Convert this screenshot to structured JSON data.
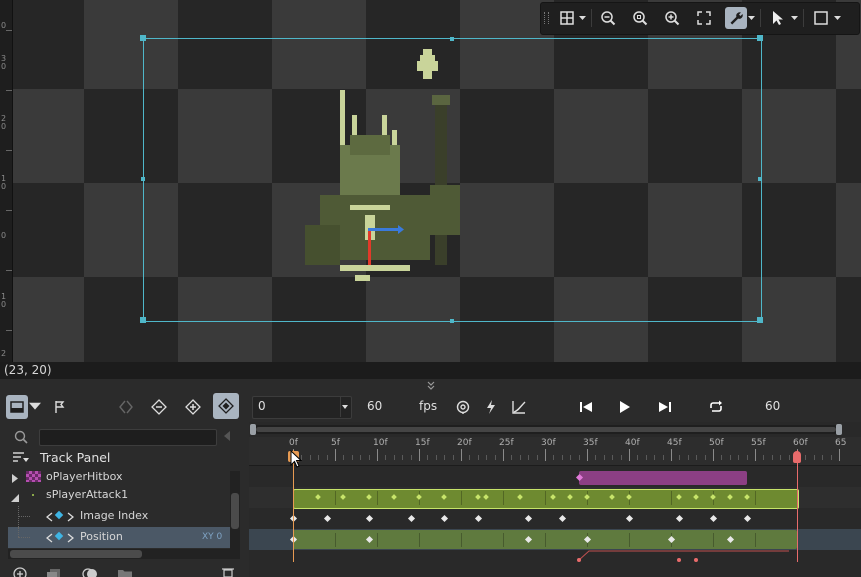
{
  "canvas": {
    "ruler_labels": [
      "0",
      "3",
      "0",
      "2",
      "0",
      "1",
      "0",
      "0",
      "1",
      "0",
      "2"
    ],
    "coords": "(23, 20)"
  },
  "toolbar": {
    "buttons": [
      {
        "name": "grid-icon"
      },
      {
        "name": "zoom-out-icon"
      },
      {
        "name": "zoom-reset-icon"
      },
      {
        "name": "zoom-in-icon"
      },
      {
        "name": "fit-screen-icon"
      },
      {
        "name": "wrench-icon",
        "active": true
      },
      {
        "name": "cursor-icon"
      },
      {
        "name": "square-icon"
      }
    ]
  },
  "controls": {
    "frame": "0",
    "fps_value": "60",
    "fps_label": "fps",
    "length": "60"
  },
  "track_panel": {
    "title": "Track Panel",
    "items": [
      {
        "label": "oPlayerHitbox",
        "indent": 0
      },
      {
        "label": "sPlayerAttack1",
        "indent": 0
      },
      {
        "label": "Image Index",
        "indent": 1
      },
      {
        "label": "Position",
        "indent": 1,
        "selected": true,
        "suffix": "XY  0"
      }
    ]
  },
  "timeline": {
    "ruler_labels": [
      "0f",
      "5f",
      "10f",
      "15f",
      "20f",
      "25f",
      "30f",
      "35f",
      "40f",
      "45f",
      "50f",
      "55f",
      "60f",
      "65"
    ],
    "total_frames": 60,
    "current_frame": 0,
    "tracks": [
      {
        "name": "oPlayerHitbox",
        "bar_color": "#8c3f84",
        "from": 34,
        "to": 54
      },
      {
        "name": "sPlayerAttack1",
        "bar_color": "#7a9a35",
        "from": 0,
        "to": 60,
        "keys": [
          3,
          6,
          9,
          12,
          15,
          18,
          22,
          23,
          27,
          31,
          33,
          35,
          38,
          40,
          46,
          48,
          50,
          52,
          54
        ]
      },
      {
        "name": "Image Index",
        "keys": [
          0,
          4,
          9,
          14,
          18,
          22,
          28,
          32,
          40,
          46,
          50,
          54
        ]
      },
      {
        "name": "Position",
        "keys": [
          0,
          9,
          28,
          35,
          45,
          52
        ]
      }
    ],
    "colors": {
      "playhead": "#e79a52",
      "end_marker": "#e86b6b",
      "bbox": "#4fb7c9"
    }
  }
}
